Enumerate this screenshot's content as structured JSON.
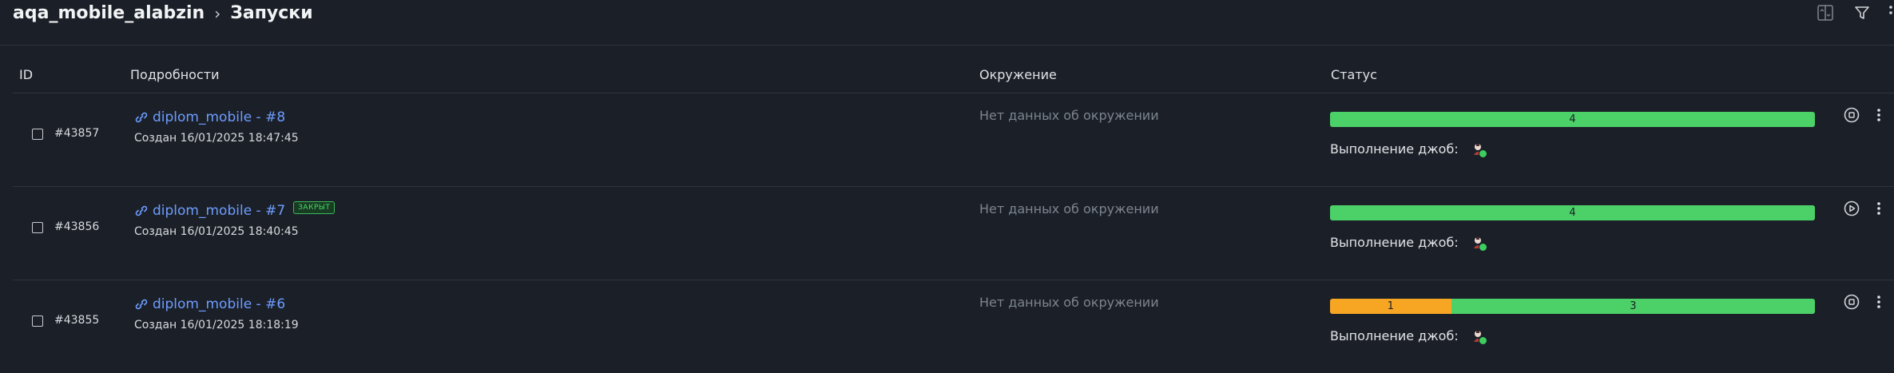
{
  "breadcrumb": {
    "project": "aqa_mobile_alabzin",
    "page": "Запуски"
  },
  "table": {
    "headers": {
      "id": "ID",
      "details": "Подробности",
      "env": "Окружение",
      "status": "Статус"
    }
  },
  "rows": [
    {
      "id": "#43857",
      "link": "diplom_mobile - #8",
      "badge": "",
      "created": "Создан 16/01/2025 18:47:45",
      "env": "Нет данных об окружении",
      "status": [
        {
          "color": "green",
          "value": "4"
        }
      ],
      "jobs_label": "Выполнение джоб:",
      "action_icon": "stop-icon"
    },
    {
      "id": "#43856",
      "link": "diplom_mobile - #7",
      "badge": "ЗАКРЫТ",
      "created": "Создан 16/01/2025 18:40:45",
      "env": "Нет данных об окружении",
      "status": [
        {
          "color": "green",
          "value": "4"
        }
      ],
      "jobs_label": "Выполнение джоб:",
      "action_icon": "play-icon"
    },
    {
      "id": "#43855",
      "link": "diplom_mobile - #6",
      "badge": "",
      "created": "Создан 16/01/2025 18:18:19",
      "env": "Нет данных об окружении",
      "status": [
        {
          "color": "orange",
          "value": "1"
        },
        {
          "color": "green",
          "value": "3"
        }
      ],
      "jobs_label": "Выполнение джоб:",
      "action_icon": "stop-icon"
    }
  ],
  "colors": {
    "green": "#4cd068",
    "orange": "#f6a623",
    "link": "#6d9cff",
    "background": "#1b2028"
  }
}
